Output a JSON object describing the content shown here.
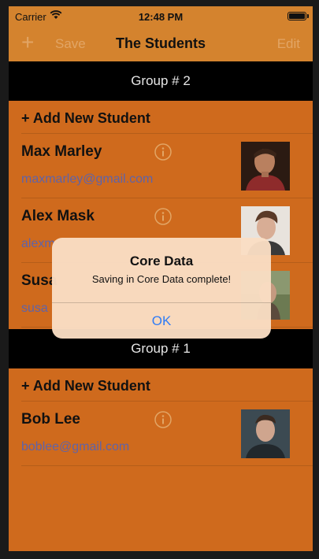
{
  "status_bar": {
    "carrier": "Carrier",
    "time": "12:48 PM"
  },
  "nav": {
    "add_icon": "+",
    "save_label": "Save",
    "title": "The Students",
    "edit_label": "Edit"
  },
  "sections": [
    {
      "header": "Group # 2",
      "add_label": "+ Add New Student",
      "students": [
        {
          "name": "Max Marley",
          "email": "maxmarley@gmail.com"
        },
        {
          "name": "Alex Mask",
          "email": "alexm"
        },
        {
          "name": "Susa",
          "email": "susa"
        }
      ]
    },
    {
      "header": "Group # 1",
      "add_label": "+ Add New Student",
      "students": [
        {
          "name": "Bob Lee",
          "email": "boblee@gmail.com"
        }
      ]
    }
  ],
  "alert": {
    "title": "Core Data",
    "message": "Saving in Core Data complete!",
    "button": "OK"
  },
  "colors": {
    "background": "#cf6a1d",
    "bar": "#d4832e",
    "email": "#5f63a8",
    "link": "#2f7cf6"
  }
}
